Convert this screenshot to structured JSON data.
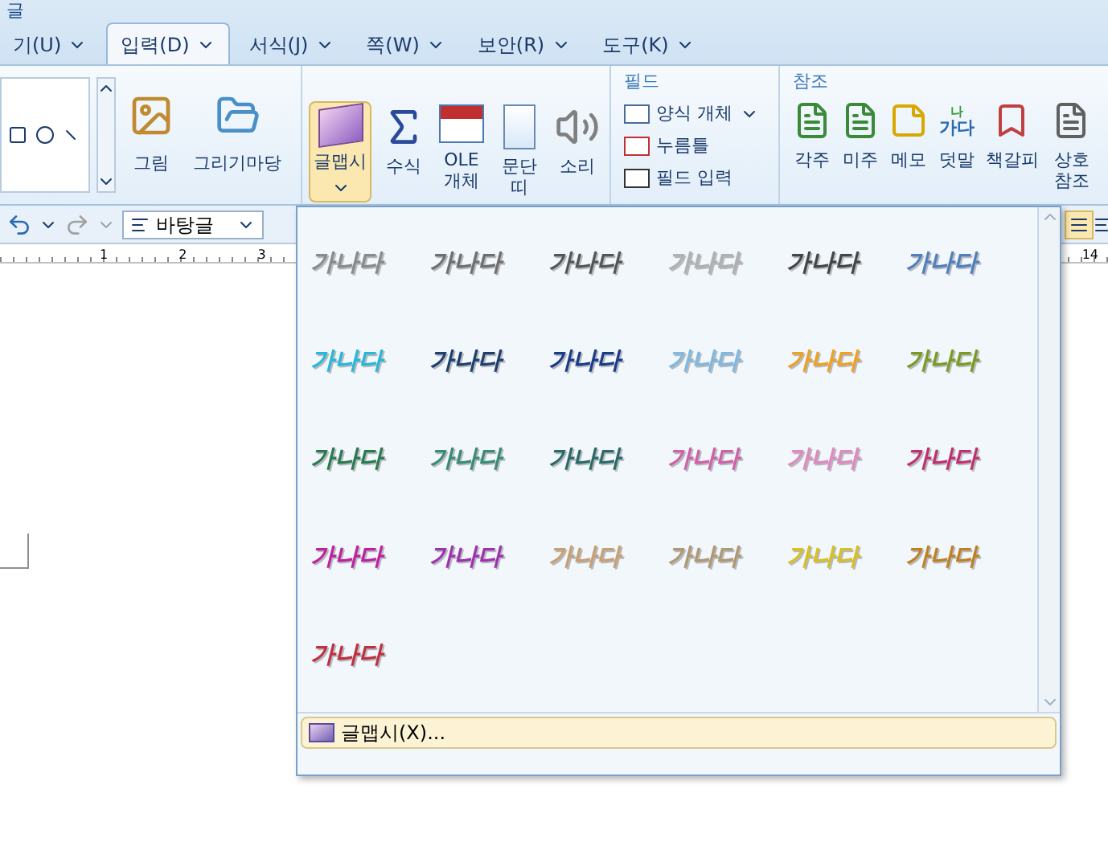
{
  "window": {
    "title": "글"
  },
  "tabs": [
    {
      "label": "기(U)",
      "selected": false
    },
    {
      "label": "입력(D)",
      "selected": true
    },
    {
      "label": "서식(J)",
      "selected": false
    },
    {
      "label": "쪽(W)",
      "selected": false
    },
    {
      "label": "보안(R)",
      "selected": false
    },
    {
      "label": "도구(K)",
      "selected": false
    }
  ],
  "ribbon": {
    "insert_buttons": [
      {
        "label": "그림",
        "kind": "picture",
        "selected": false
      },
      {
        "label": "그리기마당",
        "kind": "folder",
        "selected": false
      }
    ],
    "object_buttons": [
      {
        "label": "글맵시",
        "kind": "wordart",
        "selected": true
      },
      {
        "label": "수식",
        "kind": "formula",
        "selected": false
      },
      {
        "label": "OLE 개체",
        "kind": "ole",
        "selected": false
      },
      {
        "label": "문단 띠",
        "kind": "band",
        "selected": false
      },
      {
        "label": "소리",
        "kind": "sound",
        "selected": false
      }
    ],
    "field_group": {
      "title": "필드",
      "items": [
        {
          "label": "양식 개체",
          "kind": "form"
        },
        {
          "label": "누름틀",
          "kind": "click"
        },
        {
          "label": "필드 입력",
          "kind": "field"
        }
      ]
    },
    "reference_group": {
      "title": "참조",
      "items": [
        {
          "label": "각주",
          "kind": "footnote"
        },
        {
          "label": "미주",
          "kind": "endnote"
        },
        {
          "label": "메모",
          "kind": "memo"
        },
        {
          "label": "덧말",
          "kind": "ruby",
          "icon_text": [
            "나",
            "가다"
          ]
        },
        {
          "label": "책갈피",
          "kind": "bookmark"
        },
        {
          "label": "상호 참조",
          "kind": "crossref"
        }
      ]
    }
  },
  "toolbar": {
    "style_select": "바탕글"
  },
  "ruler": {
    "labels": [
      "1",
      "2",
      "3",
      "14"
    ]
  },
  "wordart_gallery": {
    "items": [
      {
        "text": "가나다",
        "color": "#8a8a8a"
      },
      {
        "text": "가나다",
        "color": "#6e6e6e"
      },
      {
        "text": "가나다",
        "color": "#555555"
      },
      {
        "text": "가나다",
        "color": "#b0b0b0"
      },
      {
        "text": "가나다",
        "color": "#444444"
      },
      {
        "text": "가나다",
        "color": "#4f7fbf"
      },
      {
        "text": "가나다",
        "color": "#25b8d8"
      },
      {
        "text": "가나다",
        "color": "#1d3f6e"
      },
      {
        "text": "가나다",
        "color": "#1a3a8a"
      },
      {
        "text": "가나다",
        "color": "#7fb8e0"
      },
      {
        "text": "가나다",
        "color": "#f0a020"
      },
      {
        "text": "가나다",
        "color": "#7a9a20"
      },
      {
        "text": "가나다",
        "color": "#2a7a50"
      },
      {
        "text": "가나다",
        "color": "#3a8a78"
      },
      {
        "text": "가나다",
        "color": "#2a6a6a"
      },
      {
        "text": "가나다",
        "color": "#d060a8"
      },
      {
        "text": "가나다",
        "color": "#e088c0"
      },
      {
        "text": "가나다",
        "color": "#c03070"
      },
      {
        "text": "가나다",
        "color": "#c020a0"
      },
      {
        "text": "가나다",
        "color": "#a030b0"
      },
      {
        "text": "가나다",
        "color": "#c8a070"
      },
      {
        "text": "가나다",
        "color": "#b09870"
      },
      {
        "text": "가나다",
        "color": "#d8c020"
      },
      {
        "text": "가나다",
        "color": "#c08020"
      },
      {
        "text": "가나다",
        "color": "#c03040"
      }
    ],
    "footer_button": "글맵시(X)..."
  }
}
